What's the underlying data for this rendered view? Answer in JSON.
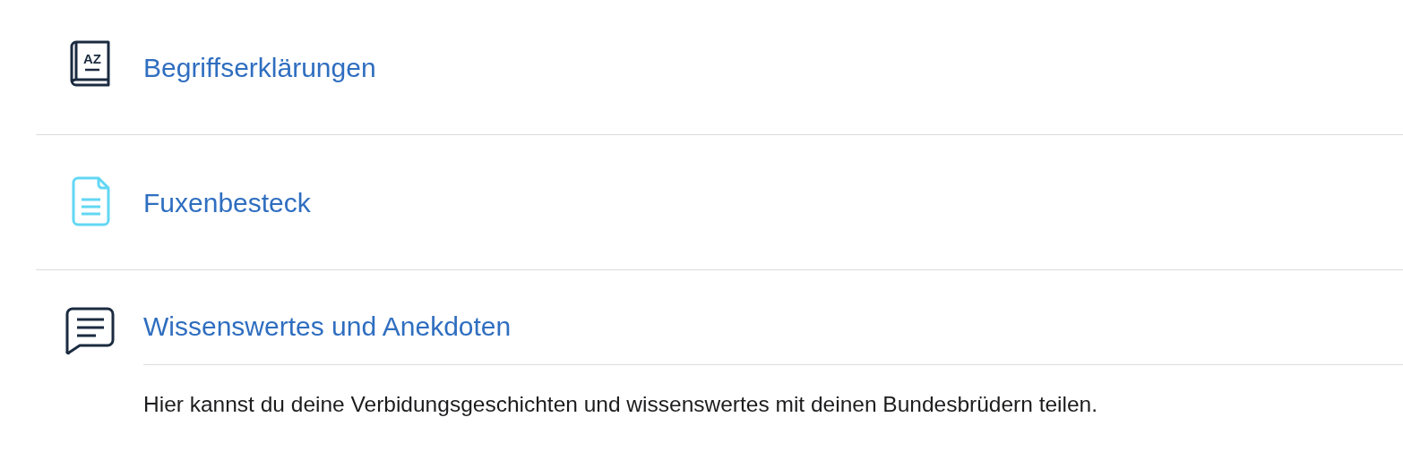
{
  "items": [
    {
      "kind": "book",
      "icon_text": "AZ",
      "title": "Begriffserklärungen"
    },
    {
      "kind": "document",
      "title": "Fuxenbesteck"
    },
    {
      "kind": "chat",
      "title": "Wissenswertes und Anekdoten",
      "description": "Hier kannst du deine Verbidungsgeschichten und wissenswertes mit deinen Bundesbrüdern teilen."
    }
  ]
}
